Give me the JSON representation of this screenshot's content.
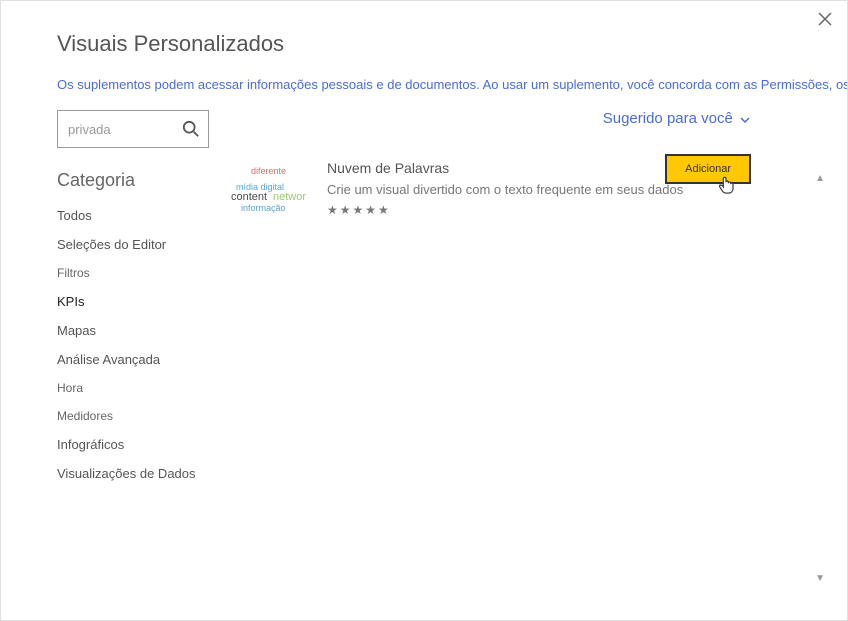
{
  "header": {
    "title": "Visuais Personalizados",
    "disclaimer": "Os suplementos podem acessar informações pessoais e de documentos. Ao usar um suplemento, você concorda com as Permissões, os Term"
  },
  "search": {
    "value": "privada"
  },
  "sidebar": {
    "category_label": "Categoria",
    "items": [
      {
        "label": "Todos",
        "sub": false,
        "active": false
      },
      {
        "label": "Seleções do Editor",
        "sub": false,
        "active": false
      },
      {
        "label": "Filtros",
        "sub": true,
        "active": false
      },
      {
        "label": "KPIs",
        "sub": false,
        "active": true
      },
      {
        "label": "Mapas",
        "sub": false,
        "active": false
      },
      {
        "label": "Análise Avançada",
        "sub": false,
        "active": false
      },
      {
        "label": "Hora",
        "sub": true,
        "active": false
      },
      {
        "label": "Medidores",
        "sub": true,
        "active": false
      },
      {
        "label": "Infográficos",
        "sub": false,
        "active": false
      },
      {
        "label": "Visualizações de Dados",
        "sub": false,
        "active": false
      }
    ]
  },
  "main": {
    "suggested_label": "Sugerido para você",
    "result": {
      "title": "Nuvem de Palavras",
      "description": "Crie um visual divertido com o texto frequente em seus dados",
      "rating": "★★★★★",
      "add_label": "Adicionar",
      "wordcloud": {
        "w1": "diferente",
        "w2": "mídia digital",
        "w3": "content",
        "w4": "networ",
        "w5": "informação"
      }
    }
  }
}
